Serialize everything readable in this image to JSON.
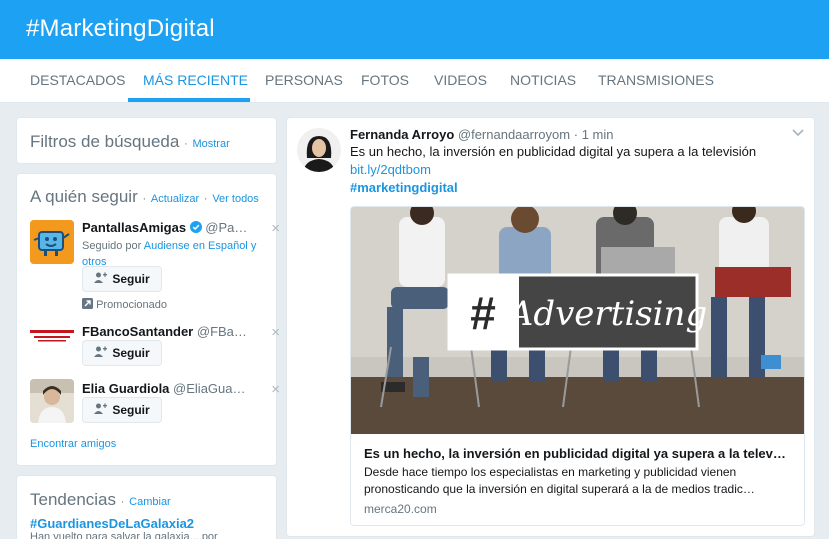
{
  "header": {
    "title": "#MarketingDigital"
  },
  "nav": {
    "tabs": [
      {
        "label": "DESTACADOS"
      },
      {
        "label": "MÁS RECIENTE"
      },
      {
        "label": "PERSONAS"
      },
      {
        "label": "FOTOS"
      },
      {
        "label": "VIDEOS"
      },
      {
        "label": "NOTICIAS"
      },
      {
        "label": "TRANSMISIONES"
      }
    ],
    "active_tab": "MÁS RECIENTE"
  },
  "filters": {
    "title": "Filtros de búsqueda",
    "separator": "·",
    "action": "Mostrar"
  },
  "who_to_follow": {
    "title": "A quién seguir",
    "separator": "·",
    "refresh": "Actualizar",
    "view_all": "Ver todos",
    "items": [
      {
        "name": "PantallasAmigas",
        "handle": "@Pa…",
        "verified": true,
        "followed_by_prefix": "Seguido por",
        "followed_by": "Audiense en Español",
        "followed_by_suffix": "y otros",
        "follow_label": "Seguir",
        "promoted": "Promocionado"
      },
      {
        "name": "FBancoSantander",
        "handle": "@FBa…",
        "follow_label": "Seguir"
      },
      {
        "name": "Elia Guardiola",
        "handle": "@EliaGua…",
        "follow_label": "Seguir"
      }
    ],
    "find_friends": "Encontrar amigos",
    "close_glyph": "×"
  },
  "trends": {
    "title": "Tendencias",
    "separator": "·",
    "change": "Cambiar",
    "items": [
      {
        "tag": "#GuardianesDeLaGalaxia2",
        "desc": "Han vuelto para salvar la galaxia... por"
      }
    ]
  },
  "tweet": {
    "name": "Fernanda Arroyo",
    "handle": "@fernandaarroyom",
    "separator": "·",
    "time": "1 min",
    "text": "Es un hecho, la inversión en publicidad digital ya supera a la televisión",
    "link": "bit.ly/2qdtbom",
    "hashtag": "#marketingdigital",
    "card": {
      "image_text": "Advertising",
      "image_hash": "#",
      "title": "Es un hecho, la inversión en publicidad digital ya supera a la telev…",
      "description": "Desde hace tiempo los especialistas en marketing y publicidad vienen pronosticando que la inversión en digital superará a la de medios tradic…",
      "domain": "merca20.com"
    }
  },
  "colors": {
    "accent": "#1da1f2",
    "link": "#1b95e0",
    "background": "#e6ecf0"
  },
  "icons": {
    "verified": "verified-badge-icon",
    "follow": "person-plus-icon",
    "promoted": "promoted-arrow-icon",
    "dismiss": "close-icon",
    "menu": "chevron-down-icon"
  }
}
